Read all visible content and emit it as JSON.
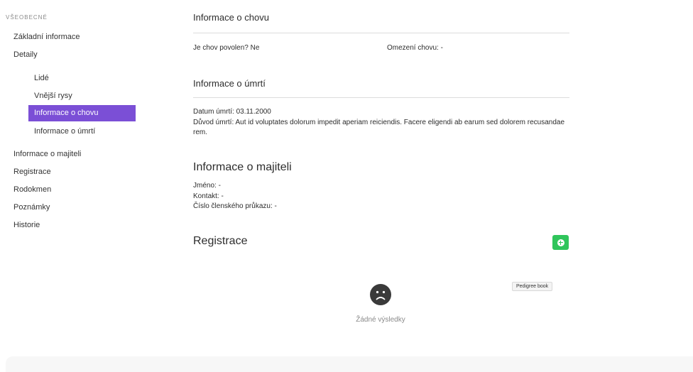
{
  "sidebar": {
    "section_title": "VŠEOBECNÉ",
    "items": [
      {
        "label": "Základní informace"
      },
      {
        "label": "Detaily"
      },
      {
        "label": "Informace o majiteli"
      },
      {
        "label": "Registrace"
      },
      {
        "label": "Rodokmen"
      },
      {
        "label": "Poznámky"
      },
      {
        "label": "Historie"
      }
    ],
    "sub_items": [
      {
        "label": "Lidé"
      },
      {
        "label": "Vnější rysy"
      },
      {
        "label": "Informace o chovu",
        "active": true
      },
      {
        "label": "Informace o úmrtí"
      }
    ],
    "active_color": "#7b4fd6"
  },
  "breeding": {
    "heading": "Informace o chovu",
    "allowed": "Je chov povolen? Ne",
    "restriction": "Omezení chovu: -"
  },
  "death": {
    "heading": "Informace o úmrtí",
    "date": "Datum úmrtí: 03.11.2000",
    "reason": "Důvod úmrtí: Aut id voluptates dolorum impedit aperiam reiciendis. Facere eligendi ab earum sed dolorem recusandae rem."
  },
  "owner": {
    "heading": "Informace o majiteli",
    "name": "Jméno: -",
    "contact": "Kontakt: -",
    "member_card": "Číslo členského průkazu: -"
  },
  "registration": {
    "heading": "Registrace",
    "add_button_icon": "plus-circle-icon",
    "add_button_color": "#2fc55b",
    "tooltip": "Pedigree book",
    "empty_icon": "sad-face-icon",
    "empty_text": "Žádné výsledky"
  }
}
